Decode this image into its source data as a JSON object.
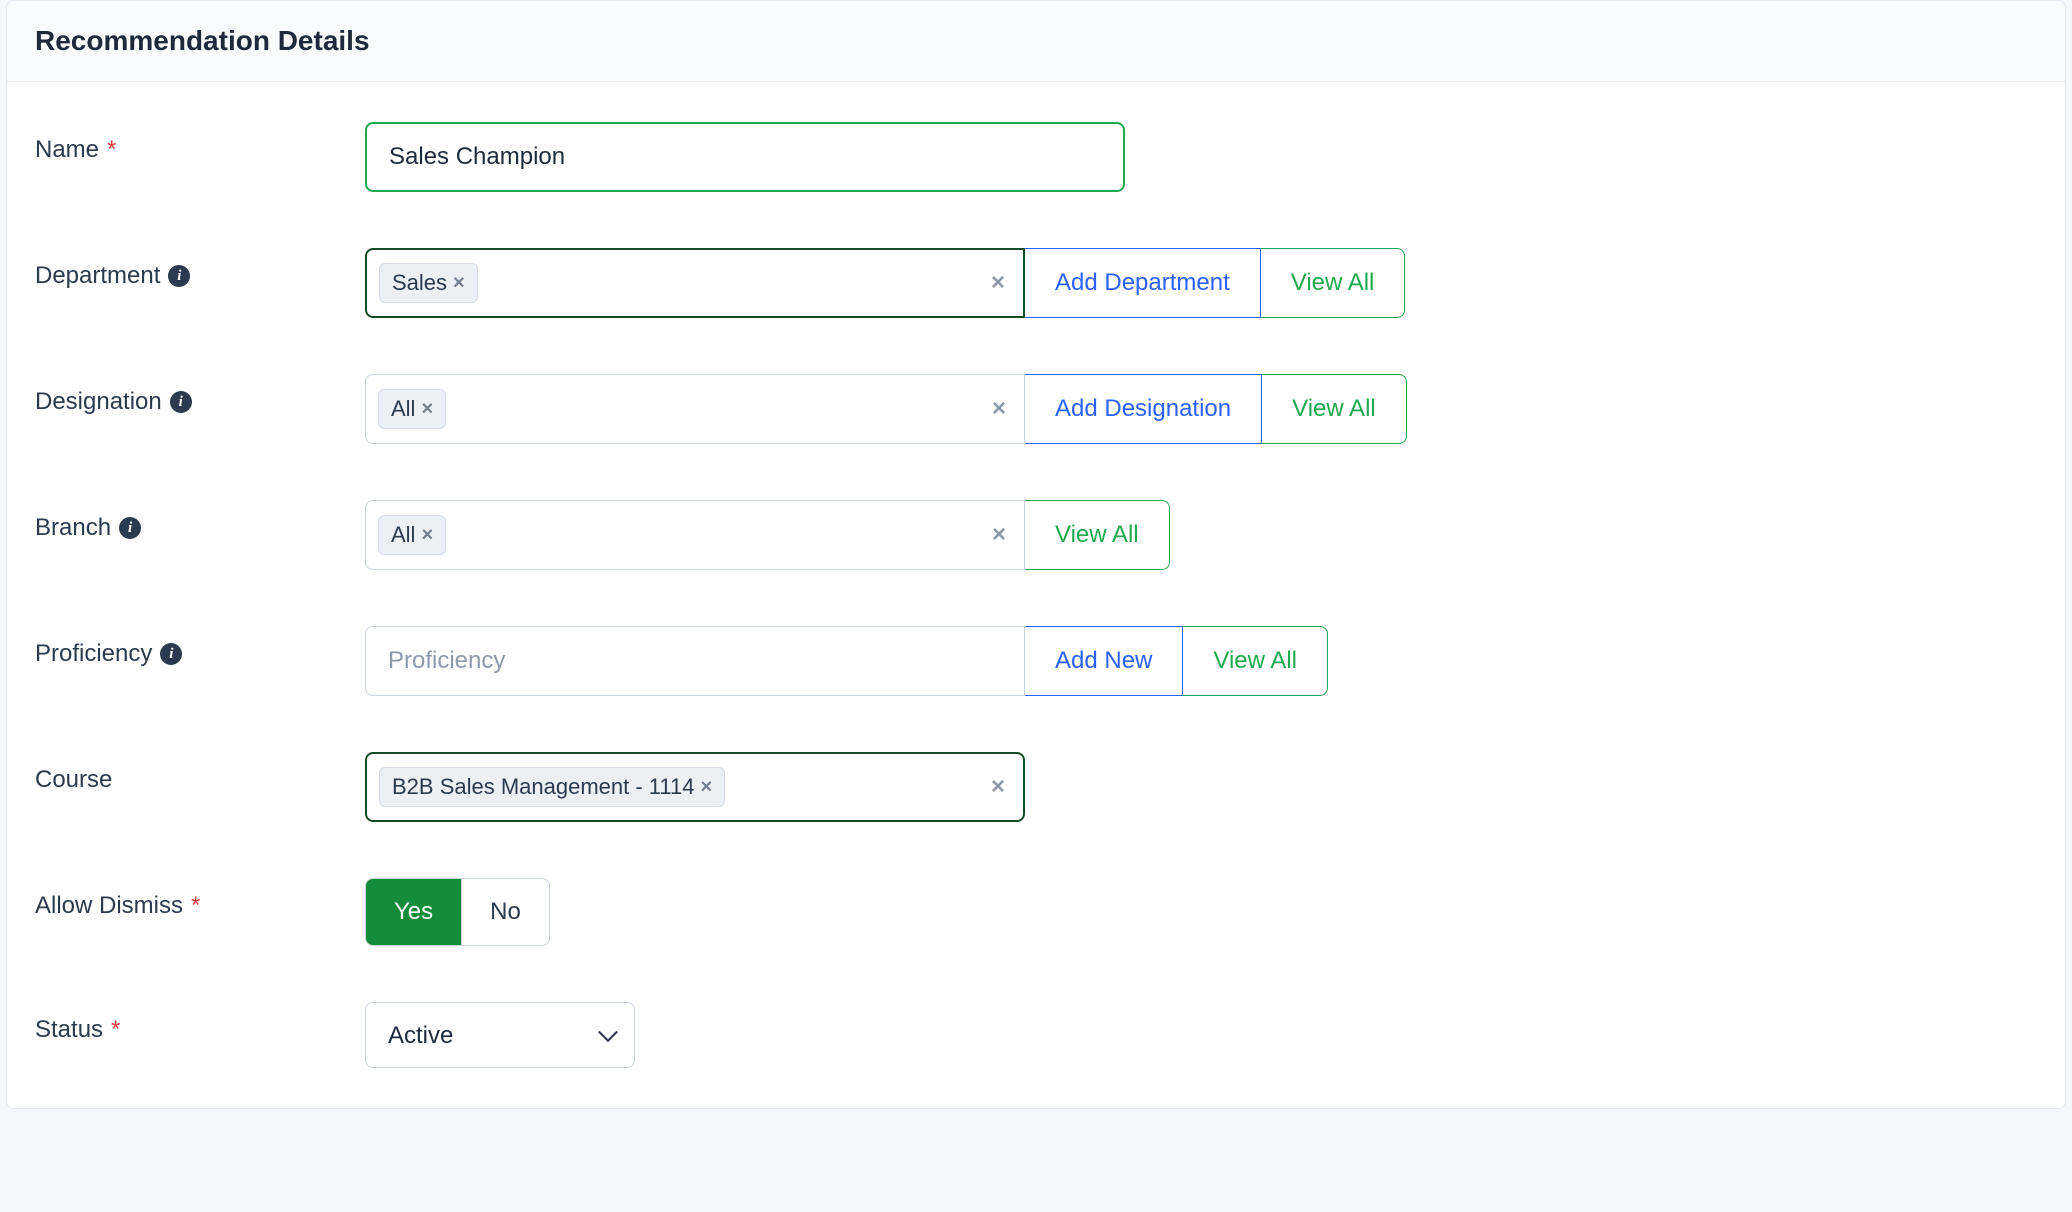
{
  "header": {
    "title": "Recommendation Details"
  },
  "fields": {
    "name": {
      "label": "Name",
      "required": true,
      "info": false,
      "value": "Sales Champion"
    },
    "department": {
      "label": "Department",
      "required": false,
      "info": true,
      "chips": [
        "Sales"
      ],
      "add_label": "Add Department",
      "view_label": "View All"
    },
    "designation": {
      "label": "Designation",
      "required": false,
      "info": true,
      "chips": [
        "All"
      ],
      "add_label": "Add Designation",
      "view_label": "View All"
    },
    "branch": {
      "label": "Branch",
      "required": false,
      "info": true,
      "chips": [
        "All"
      ],
      "view_label": "View All"
    },
    "proficiency": {
      "label": "Proficiency",
      "required": false,
      "info": true,
      "placeholder": "Proficiency",
      "add_label": "Add New",
      "view_label": "View All"
    },
    "course": {
      "label": "Course",
      "required": false,
      "info": false,
      "chips": [
        "B2B Sales Management - 1114"
      ]
    },
    "allow_dismiss": {
      "label": "Allow Dismiss",
      "required": true,
      "yes": "Yes",
      "no": "No",
      "value": "Yes"
    },
    "status": {
      "label": "Status",
      "required": true,
      "value": "Active"
    }
  }
}
